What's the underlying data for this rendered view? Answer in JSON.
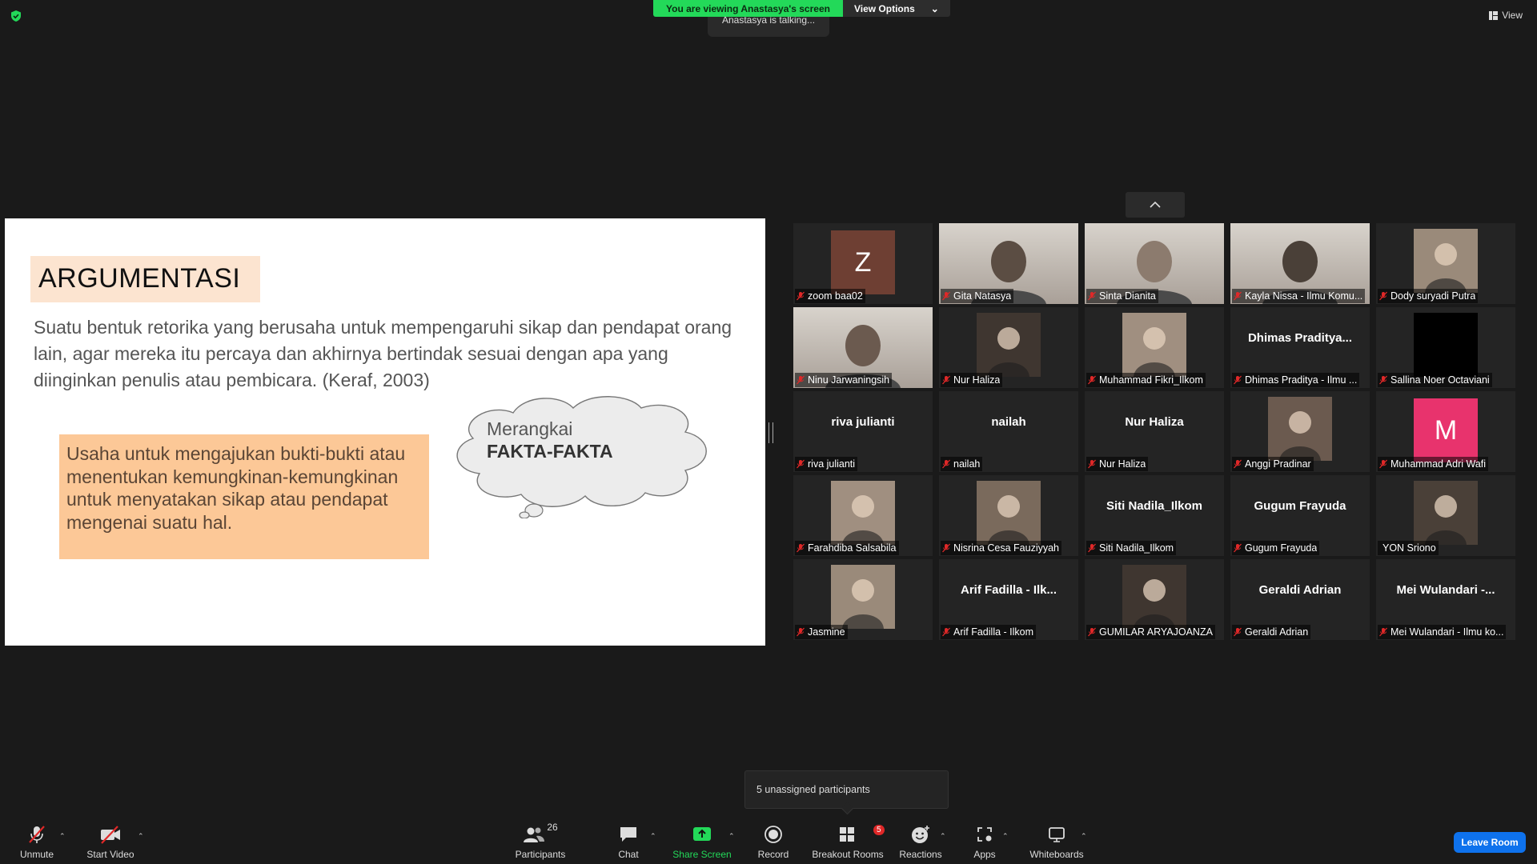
{
  "top": {
    "banner_text": "You are viewing Anastasya's screen",
    "view_options": "View Options",
    "talking": "Anastasya is talking...",
    "view_button": "View"
  },
  "slide": {
    "title": "ARGUMENTASI",
    "definition": "Suatu bentuk retorika yang berusaha untuk mempengaruhi sikap dan pendapat orang lain, agar mereka itu percaya dan akhirnya bertindak sesuai dengan apa yang diinginkan penulis atau pembicara. (Keraf, 2003)",
    "box_text": "Usaha untuk mengajukan bukti-bukti atau menentukan kemungkinan-kemungkinan untuk menyatakan sikap atau pendapat mengenai suatu hal.",
    "cloud_line1": "Merangkai",
    "cloud_line2": "FAKTA-FAKTA"
  },
  "colors": {
    "banner_green": "#23d959",
    "leave_blue": "#0e72ed",
    "title_bg": "#fce4d0",
    "box_bg": "#fcc897",
    "muted_red": "#e02828"
  },
  "participants": [
    {
      "label": "zoom baa02",
      "avatar_letter": "Z",
      "avatar_color": "#6e3f33",
      "muted": true
    },
    {
      "label": "Gita Natasya",
      "video": true,
      "muted": true
    },
    {
      "label": "Sinta Dianita",
      "video": true,
      "muted": true
    },
    {
      "label": "Kayla Nissa - Ilmu Komu...",
      "video": true,
      "muted": true
    },
    {
      "label": "Dody suryadi Putra",
      "photo": true,
      "muted": true
    },
    {
      "label": "Ninu Jarwaningsih",
      "video": true,
      "muted": true
    },
    {
      "label": "Nur Haliza",
      "photo": true,
      "muted": true
    },
    {
      "label": "Muhammad Fikri_Ilkom",
      "photo": true,
      "muted": true
    },
    {
      "label": "Dhimas Praditya - Ilmu ...",
      "center_name": "Dhimas  Praditya...",
      "muted": true
    },
    {
      "label": "Sallina Noer Octaviani",
      "black": true,
      "muted": true
    },
    {
      "label": "riva julianti",
      "center_name": "riva julianti",
      "muted": true
    },
    {
      "label": "nailah",
      "center_name": "nailah",
      "muted": true
    },
    {
      "label": "Nur Haliza",
      "center_name": "Nur Haliza",
      "muted": true
    },
    {
      "label": "Anggi Pradinar",
      "photo": true,
      "muted": true
    },
    {
      "label": "Muhammad Adri Wafi",
      "avatar_letter": "M",
      "avatar_color": "#e8336d",
      "muted": true
    },
    {
      "label": "Farahdiba Salsabila",
      "photo": true,
      "muted": true
    },
    {
      "label": "Nisrina Cesa Fauziyyah",
      "photo": true,
      "muted": true
    },
    {
      "label": "Siti Nadila_Ilkom",
      "center_name": "Siti Nadila_Ilkom",
      "muted": true
    },
    {
      "label": "Gugum Frayuda",
      "center_name": "Gugum Frayuda",
      "muted": true
    },
    {
      "label": "YON Sriono",
      "photo": true,
      "muted": false
    },
    {
      "label": "Jasmine",
      "photo": true,
      "muted": true
    },
    {
      "label": "Arif Fadilla - Ilkom",
      "center_name": "Arif Fadilla - Ilk...",
      "muted": true
    },
    {
      "label": "GUMILAR ARYAJOANZA",
      "photo": true,
      "muted": true
    },
    {
      "label": "Geraldi Adrian",
      "center_name": "Geraldi Adrian",
      "muted": true
    },
    {
      "label": "Mei Wulandari - Ilmu ko...",
      "center_name": "Mei  Wulandari  -...",
      "muted": true
    }
  ],
  "popup": {
    "text": "5 unassigned participants"
  },
  "toolbar": {
    "unmute": "Unmute",
    "start_video": "Start Video",
    "participants": "Participants",
    "participants_count": "26",
    "chat": "Chat",
    "share_screen": "Share Screen",
    "record": "Record",
    "breakout_rooms": "Breakout Rooms",
    "breakout_badge": "5",
    "reactions": "Reactions",
    "apps": "Apps",
    "whiteboards": "Whiteboards",
    "leave_room": "Leave Room"
  }
}
